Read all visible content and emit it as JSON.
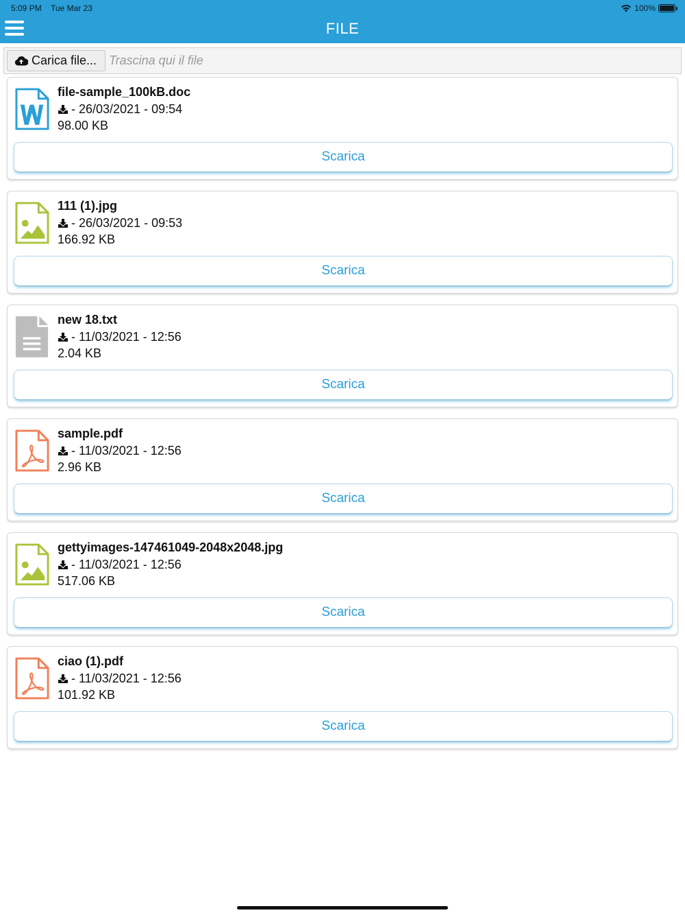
{
  "status_bar": {
    "time": "5:09 PM",
    "date": "Tue Mar 23",
    "battery": "100%",
    "battery_level": 1.0
  },
  "header": {
    "title": "FILE",
    "menu_icon": "hamburger-menu-icon",
    "color": "#2a9fd8"
  },
  "upload": {
    "button_label": "Carica file...",
    "button_icon": "cloud-upload-icon",
    "drop_hint": "Trascina qui il file"
  },
  "files": [
    {
      "name": "file-sample_100kB.doc",
      "date": "- 26/03/2021 - 09:54",
      "size": "98.00 KB",
      "icon": "word-doc-icon",
      "color": "#2a9fd8",
      "action": "Scarica"
    },
    {
      "name": "111 (1).jpg",
      "date": "- 26/03/2021 - 09:53",
      "size": "166.92 KB",
      "icon": "image-file-icon",
      "color": "#a8c43a",
      "action": "Scarica"
    },
    {
      "name": "new 18.txt",
      "date": "- 11/03/2021 - 12:56",
      "size": "2.04 KB",
      "icon": "text-file-icon",
      "color": "#bdbdbd",
      "action": "Scarica"
    },
    {
      "name": "sample.pdf",
      "date": "- 11/03/2021 - 12:56",
      "size": "2.96 KB",
      "icon": "pdf-file-icon",
      "color": "#f0805a",
      "action": "Scarica"
    },
    {
      "name": "gettyimages-147461049-2048x2048.jpg",
      "date": "- 11/03/2021 - 12:56",
      "size": "517.06 KB",
      "icon": "image-file-icon",
      "color": "#a8c43a",
      "action": "Scarica"
    },
    {
      "name": "ciao (1).pdf",
      "date": "- 11/03/2021 - 12:56",
      "size": "101.92 KB",
      "icon": "pdf-file-icon",
      "color": "#f0805a",
      "action": "Scarica"
    }
  ]
}
